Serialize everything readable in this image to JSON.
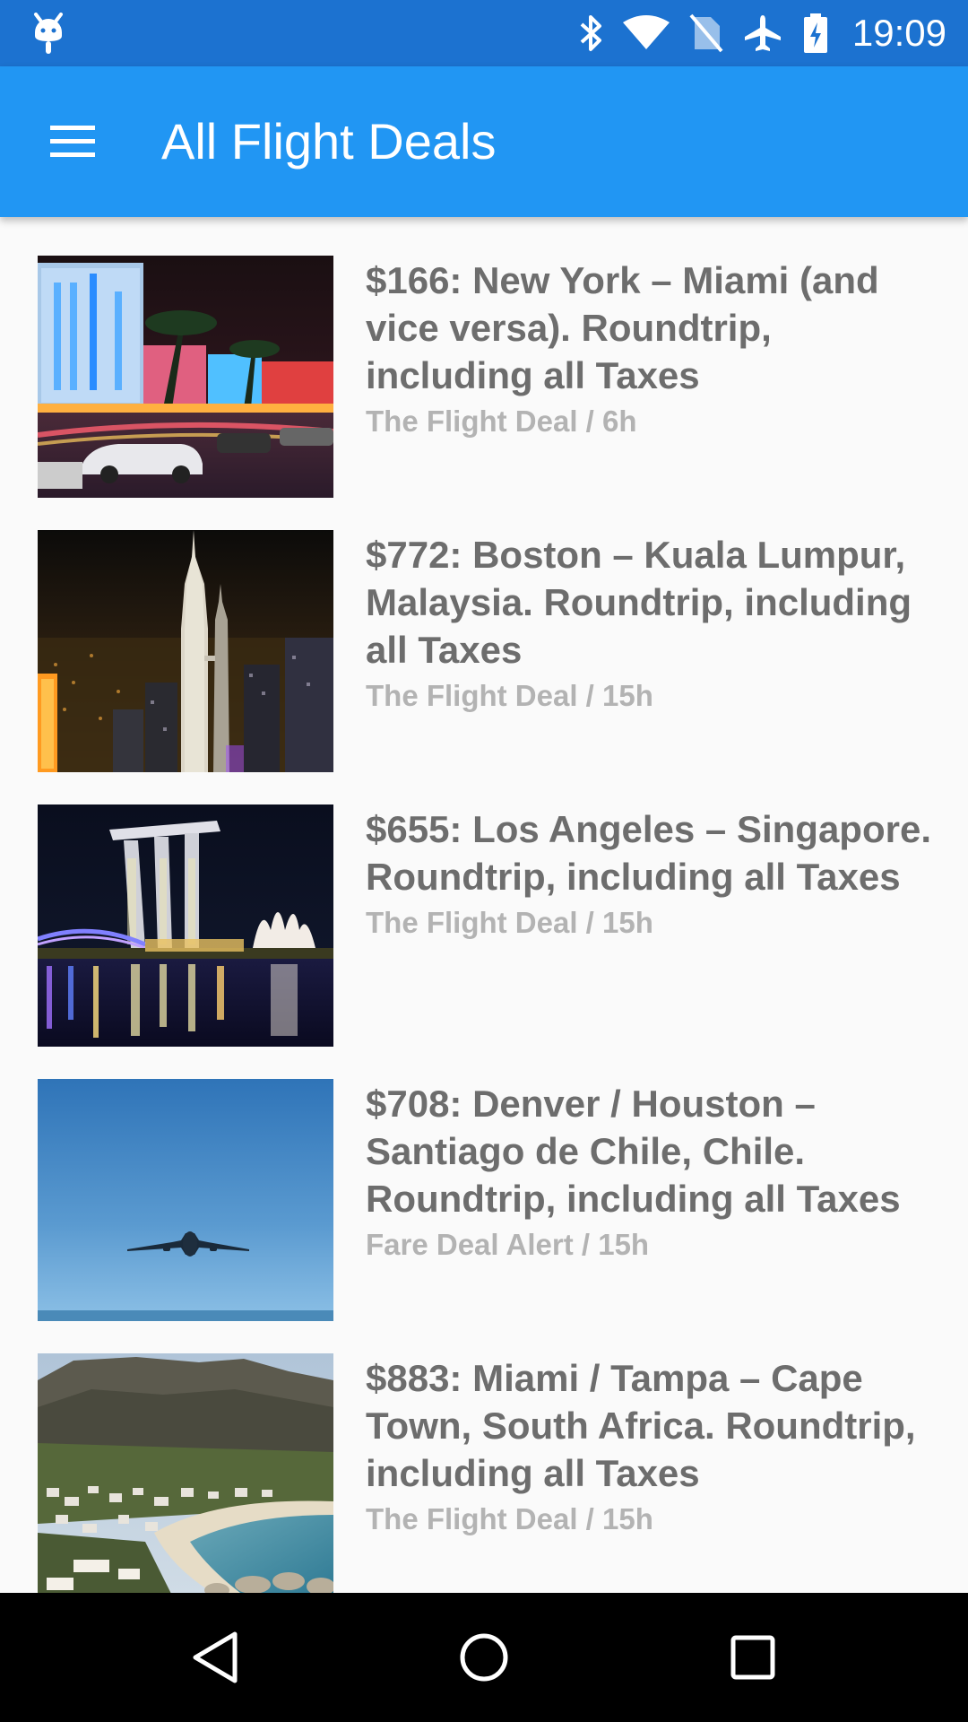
{
  "status_bar": {
    "time": "19:09",
    "icons": [
      "android-debug-icon",
      "bluetooth-icon",
      "wifi-icon",
      "no-sim-icon",
      "airplane-icon",
      "battery-charging-icon"
    ]
  },
  "app_bar": {
    "title": "All Flight Deals",
    "menu_icon": "hamburger-menu-icon"
  },
  "deals": [
    {
      "title": "$166: New York – Miami (and vice versa). Roundtrip, including all Taxes",
      "source": "The Flight Deal / 6h",
      "image": "miami-night-street-photo"
    },
    {
      "title": "$772: Boston – Kuala Lumpur, Malaysia. Roundtrip, including all Taxes",
      "source": "The Flight Deal / 15h",
      "image": "kuala-lumpur-towers-night-photo"
    },
    {
      "title": "$655: Los Angeles – Singapore. Roundtrip, including all Taxes",
      "source": "The Flight Deal / 15h",
      "image": "singapore-marina-bay-night-photo"
    },
    {
      "title": "$708: Denver / Houston – Santiago de Chile, Chile. Roundtrip, including all Taxes",
      "source": "Fare Deal Alert / 15h",
      "image": "airplane-blue-sky-photo"
    },
    {
      "title": "$883: Miami / Tampa – Cape Town, South Africa. Roundtrip, including all Taxes",
      "source": "The Flight Deal / 15h",
      "image": "cape-town-coast-photo"
    }
  ],
  "nav_bar": {
    "icons": [
      "back-icon",
      "home-icon",
      "recents-icon"
    ]
  },
  "colors": {
    "status_bar": "#1c72d0",
    "app_bar": "#2196f3",
    "background": "#fafafa",
    "title_text": "#6d6d6d",
    "source_text": "#b3b3b3"
  }
}
